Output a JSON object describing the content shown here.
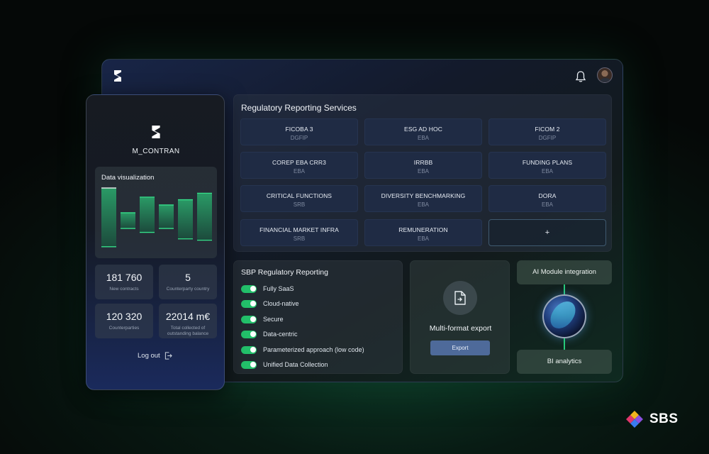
{
  "header": {
    "logo": "s-logo-icon",
    "bell": "bell-icon",
    "avatar": "user-avatar"
  },
  "services": {
    "title": "Regulatory Reporting Services",
    "items": [
      {
        "title": "FICOBA 3",
        "sub": "DGFIP"
      },
      {
        "title": "ESG AD HOC",
        "sub": "EBA"
      },
      {
        "title": "FICOM 2",
        "sub": "DGFIP"
      },
      {
        "title": "COREP EBA CRR3",
        "sub": "EBA"
      },
      {
        "title": "IRRBB",
        "sub": "EBA"
      },
      {
        "title": "FUNDING PLANS",
        "sub": "EBA"
      },
      {
        "title": "CRITICAL FUNCTIONS",
        "sub": "SRB"
      },
      {
        "title": "DIVERSITY BENCHMARKING",
        "sub": "EBA"
      },
      {
        "title": "DORA",
        "sub": "EBA"
      },
      {
        "title": "FINANCIAL MARKET INFRA",
        "sub": "SRB"
      },
      {
        "title": "REMUNERATION",
        "sub": "EBA"
      }
    ],
    "add_label": "+"
  },
  "sbp": {
    "title": "SBP Regulatory Reporting",
    "features": [
      {
        "label": "Fully SaaS",
        "on": true
      },
      {
        "label": "Cloud-native",
        "on": true
      },
      {
        "label": "Secure",
        "on": true
      },
      {
        "label": "Data-centric",
        "on": true
      },
      {
        "label": "Parameterized approach (low code)",
        "on": true
      },
      {
        "label": "Unified Data Collection",
        "on": true
      }
    ]
  },
  "export": {
    "title": "Multi-format export",
    "button": "Export",
    "icon": "file-export-icon"
  },
  "ai": {
    "top": "AI Module integration",
    "bottom": "BI analytics"
  },
  "phone": {
    "user": "M_CONTRAN",
    "dataviz_title": "Data visualization",
    "stats": [
      {
        "value": "181 760",
        "label": "New contracts"
      },
      {
        "value": "5",
        "label": "Counterparty country"
      },
      {
        "value": "120 320",
        "label": "Counterparties"
      },
      {
        "value": "22014 m€",
        "label": "Total collected of outstanding balance"
      }
    ],
    "logout": "Log out"
  },
  "chart_data": {
    "type": "bar",
    "title": "Data visualization",
    "values": [
      90,
      24,
      54,
      36,
      60,
      72
    ],
    "ylim": [
      0,
      100
    ]
  },
  "brand": {
    "name": "SBS"
  },
  "colors": {
    "accent_green": "#23c16b",
    "button_blue": "#4e6a9a"
  }
}
